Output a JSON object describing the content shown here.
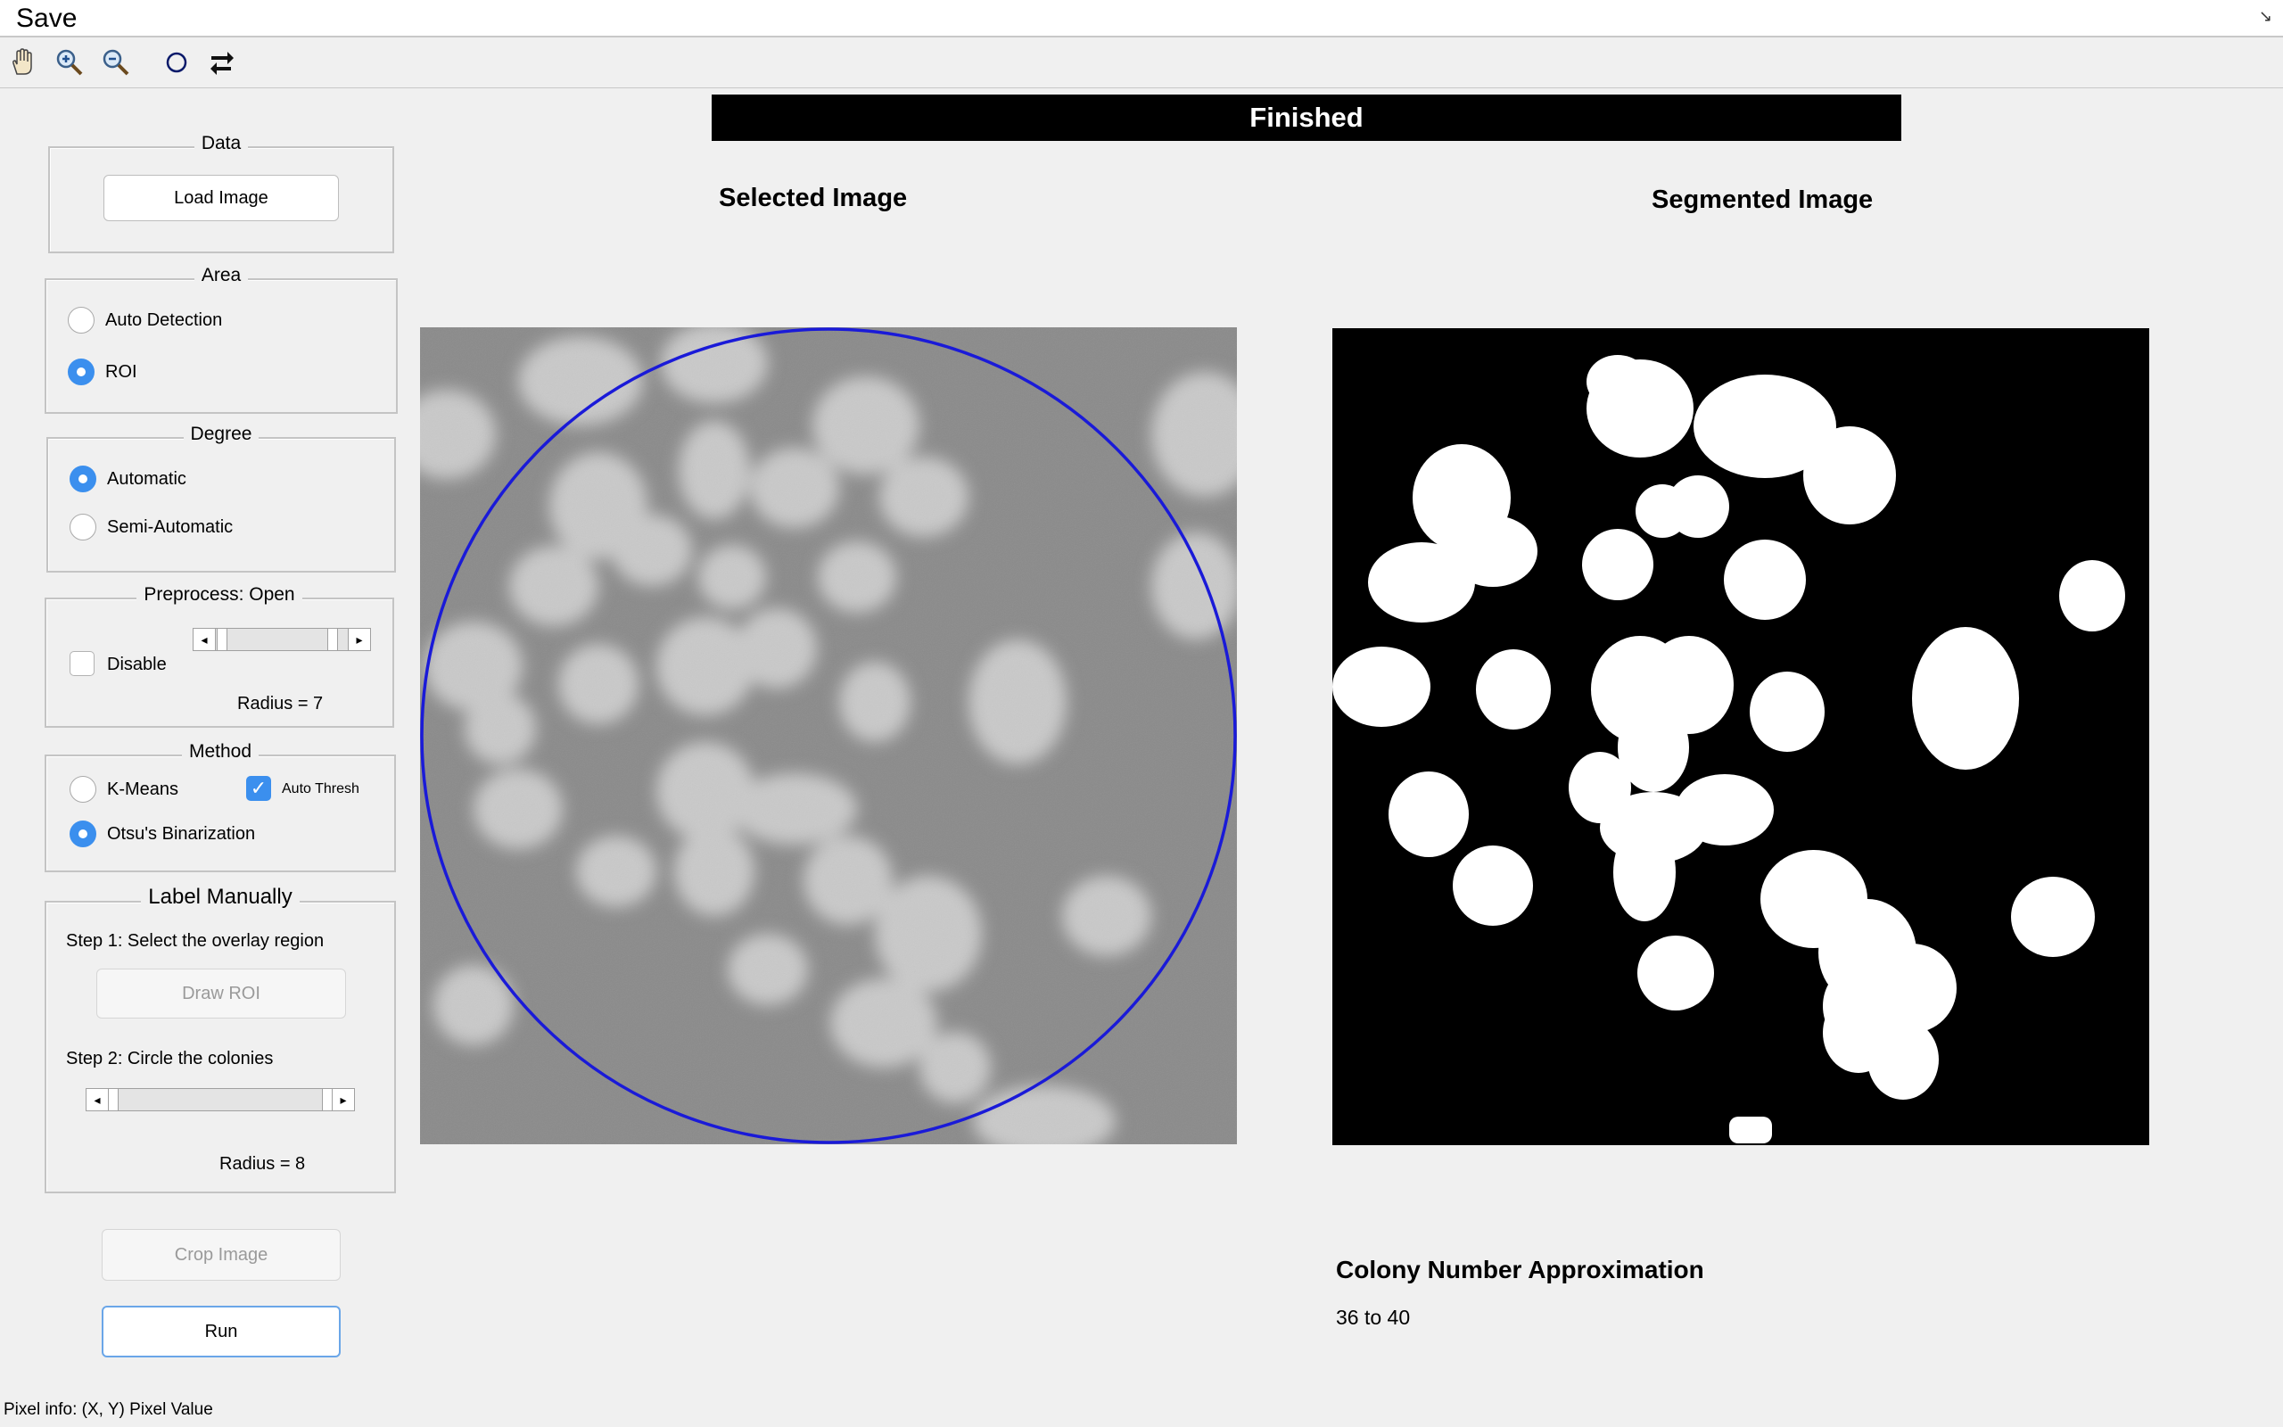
{
  "menu": {
    "save_label": "Save",
    "corner_glyph": "↘"
  },
  "toolbar": {
    "tools": [
      {
        "icon": "pan-hand-icon"
      },
      {
        "icon": "zoom-in-icon"
      },
      {
        "icon": "zoom-out-icon"
      },
      {
        "icon": "circle-icon"
      },
      {
        "icon": "swap-arrows-icon"
      }
    ]
  },
  "status": {
    "text": "Finished"
  },
  "panels": {
    "data": {
      "title": "Data",
      "load_button": "Load Image"
    },
    "area": {
      "title": "Area",
      "options": [
        "Auto Detection",
        "ROI"
      ],
      "selected": "ROI"
    },
    "degree": {
      "title": "Degree",
      "options": [
        "Automatic",
        "Semi-Automatic"
      ],
      "selected": "Automatic"
    },
    "preprocess": {
      "title": "Preprocess: Open",
      "disable_label": "Disable",
      "disable_checked": false,
      "radius_label": "Radius = 7"
    },
    "method": {
      "title": "Method",
      "options": [
        "K-Means",
        "Otsu's Binarization"
      ],
      "selected": "Otsu's Binarization",
      "auto_thresh_label": "Auto Thresh",
      "auto_thresh_checked": true
    },
    "label_manually": {
      "title": "Label Manually",
      "step1": "Step 1: Select the overlay region",
      "draw_roi": "Draw ROI",
      "step2": "Step 2: Circle the colonies",
      "radius_label": "Radius = 8"
    }
  },
  "buttons": {
    "crop": "Crop Image",
    "run": "Run"
  },
  "main": {
    "selected_title": "Selected Image",
    "segmented_title": "Segmented Image",
    "colony_heading": "Colony Number Approximation",
    "colony_value": "36 to 40"
  },
  "footer": {
    "pixel_info": "Pixel info: (X, Y)  Pixel Value"
  },
  "colors": {
    "roi_circle": "#1a1ad8",
    "status_bg": "#000000",
    "accent": "#3b8fee"
  }
}
